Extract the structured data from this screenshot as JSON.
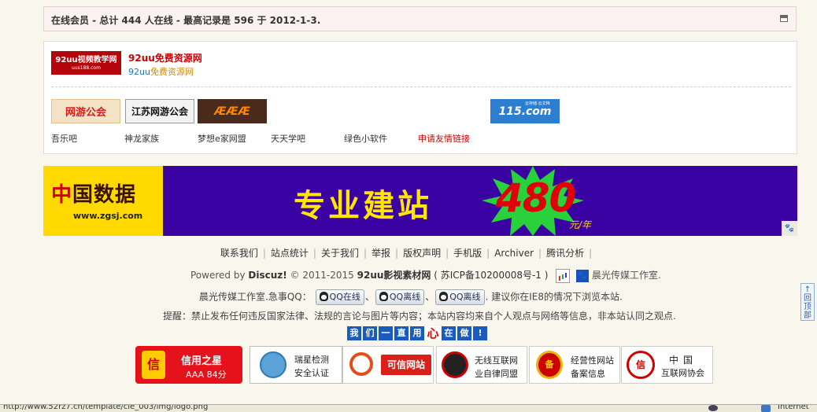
{
  "online": {
    "text": "在线会员 - 总计 444 人在线 - 最高记录是 596 于 2012-1-3."
  },
  "links": {
    "featured": {
      "logo_text": "92uu视频教学网",
      "logo_url": "uus188.com",
      "title": "92uu免费资源网",
      "subtitle_part1": "92uu",
      "subtitle_part2": "免费资源网"
    },
    "logos": [
      {
        "text": "网游公会"
      },
      {
        "text": "江苏网游公会"
      },
      {
        "text": "ÆÆÆ"
      },
      {
        "text": "115.com",
        "tag": "云存储·云文档"
      }
    ],
    "names": [
      "吾乐吧",
      "神龙家族",
      "梦想e家网盟",
      "天天学吧",
      "绿色小软件",
      "申请友情链接"
    ]
  },
  "banner": {
    "logo_zhong": "中",
    "logo_rest": "国数据",
    "logo_url": "www.zgsj.com",
    "slogan": "专业建站",
    "price": "480",
    "unit": "元/年",
    "colors": {
      "background": "#3b02a3",
      "slogan": "#ffe600",
      "price": "#e0000c",
      "burst": "#29d13a"
    }
  },
  "footer": {
    "nav": [
      "联系我们",
      "站点统计",
      "关于我们",
      "举报",
      "版权声明",
      "手机版",
      "Archiver",
      "腾讯分析"
    ],
    "powered_prefix": "Powered by",
    "powered_brand": "Discuz!",
    "copyright": "© 2011-2015",
    "site_name": "92uu影视素材网",
    "icp": "( 苏ICP备10200008号-1 )",
    "cnzz_label": "CNZZ",
    "studio": "晨光传媒工作室.",
    "contact_prefix": "晨光传媒工作室.急事QQ：",
    "qq_buttons": [
      "QQ在线",
      "QQ离线",
      "QQ离线"
    ],
    "contact_suffix": ". 建议你在IE8的情况下浏览本站.",
    "notice": "提醒：禁止发布任何违反国家法律、法规的言论与图片等内容；本站内容均来自个人观点与网络等信息，非本站认同之观点.",
    "slogan_chars": [
      "我",
      "们",
      "一",
      "直",
      "用",
      "心",
      "在",
      "做",
      "!"
    ]
  },
  "badges": {
    "credit": {
      "icon": "信",
      "title": "信用之星",
      "rating": "AAA 84分"
    },
    "ruixing": {
      "line1": "瑞星检测",
      "line2": "安全认证"
    },
    "kexin": {
      "label": "可信网站"
    },
    "wuxian": {
      "line1": "无线互联网",
      "line2": "业自律同盟"
    },
    "jingying": {
      "icon": "备",
      "line1": "经营性网站",
      "line2": "备案信息"
    },
    "china": {
      "icon": "信",
      "line1": "中国",
      "line2": "互联网协会"
    }
  },
  "backtop": {
    "label": "回顶部"
  },
  "statusbar": {
    "url": "http://www.52rz7.cn/template/cie_003/img/logo.png",
    "zone": "Internet"
  }
}
